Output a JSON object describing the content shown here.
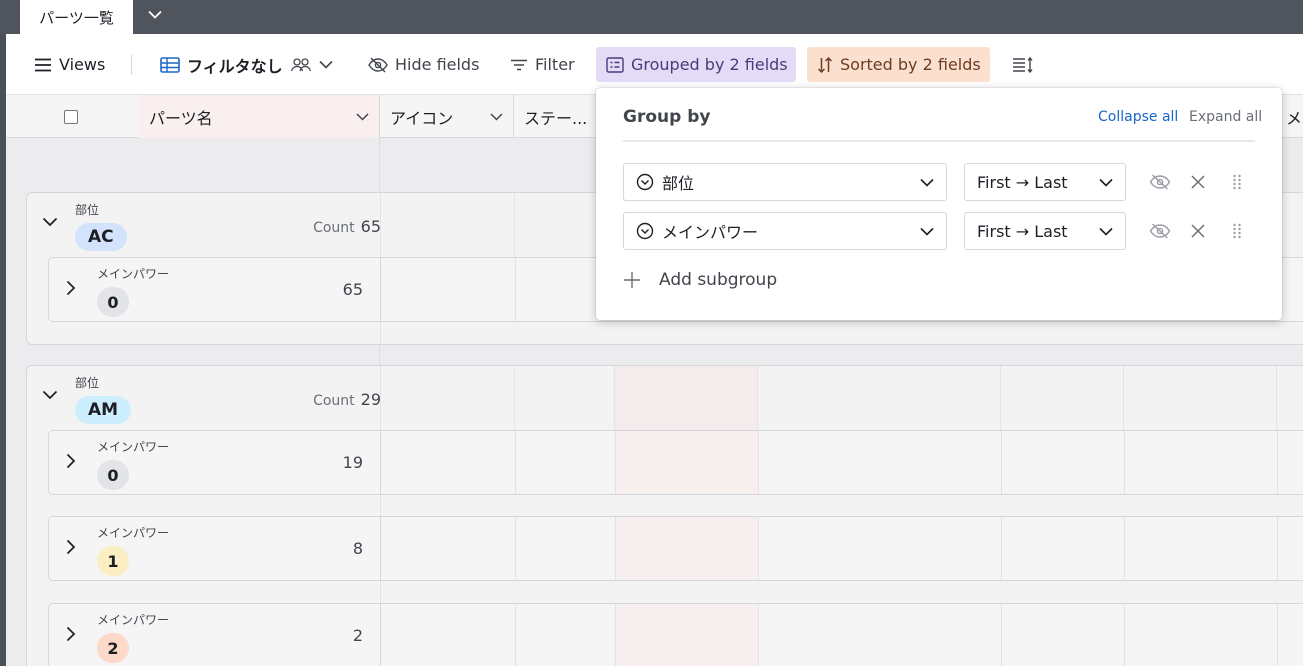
{
  "tabs": {
    "active_label": "パーツ一覧"
  },
  "toolbar": {
    "views_label": "Views",
    "view_name": "フィルタなし",
    "hide_fields_label": "Hide fields",
    "filter_label": "Filter",
    "grouped_label": "Grouped by 2 fields",
    "sorted_label": "Sorted by 2 fields"
  },
  "columns": {
    "name": "パーツ名",
    "icon": "アイコン",
    "status": "ステー...",
    "partial": "メ"
  },
  "groups": [
    {
      "field_label": "部位",
      "value": "AC",
      "count_label": "Count",
      "count": "65",
      "subgroups": [
        {
          "field_label": "メインパワー",
          "value": "0",
          "count": "65"
        }
      ]
    },
    {
      "field_label": "部位",
      "value": "AM",
      "count_label": "Count",
      "count": "29",
      "subgroups": [
        {
          "field_label": "メインパワー",
          "value": "0",
          "count": "19"
        },
        {
          "field_label": "メインパワー",
          "value": "1",
          "count": "8"
        },
        {
          "field_label": "メインパワー",
          "value": "2",
          "count": "2"
        }
      ]
    }
  ],
  "popover": {
    "title": "Group by",
    "collapse_all": "Collapse all",
    "expand_all": "Expand all",
    "rows": [
      {
        "field": "部位",
        "order": "First → Last"
      },
      {
        "field": "メインパワー",
        "order": "First → Last"
      }
    ],
    "add_subgroup": "Add subgroup"
  },
  "colors": {
    "group_pill_ac": "#d3e3fb",
    "group_pill_am": "#cdeefc",
    "pill_0": "#e2e4e9",
    "pill_1": "#fbeec2",
    "pill_2": "#fcd9c8",
    "grouped_bg": "#e4dcf6",
    "sorted_bg": "#fbe0cf",
    "link": "#1a66c9"
  }
}
